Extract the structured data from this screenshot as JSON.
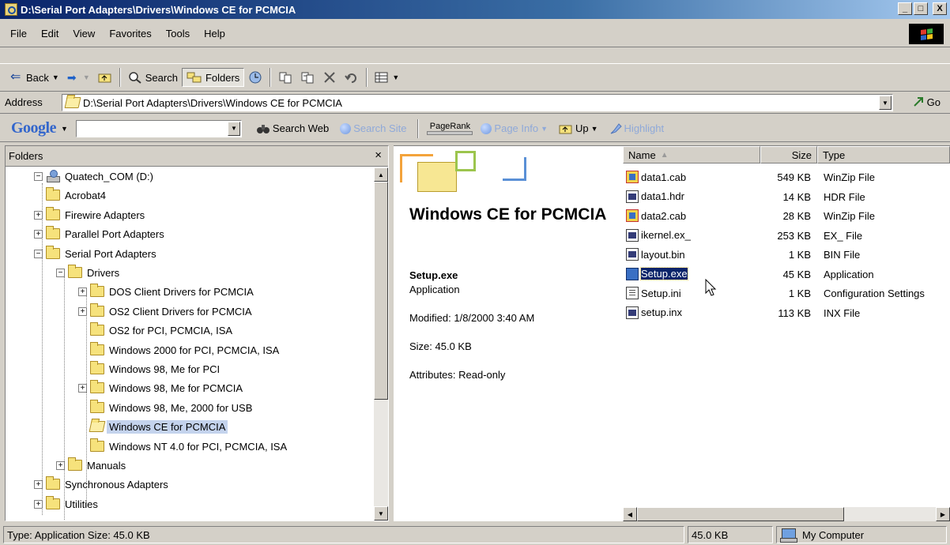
{
  "window": {
    "title": "D:\\Serial Port Adapters\\Drivers\\Windows CE for PCMCIA",
    "minimize": "_",
    "maximize": "□",
    "close": "X"
  },
  "menubar": [
    "File",
    "Edit",
    "View",
    "Favorites",
    "Tools",
    "Help"
  ],
  "toolbar": {
    "back_label": "Back",
    "search_label": "Search",
    "folders_label": "Folders"
  },
  "address": {
    "label": "Address",
    "value": "D:\\Serial Port Adapters\\Drivers\\Windows CE for PCMCIA",
    "go_label": "Go"
  },
  "googlebar": {
    "logo": "Google",
    "search_web": "Search Web",
    "search_site": "Search Site",
    "pagerank": "PageRank",
    "page_info": "Page Info",
    "up": "Up",
    "highlight": "Highlight"
  },
  "folder_pane": {
    "title": "Folders",
    "close": "×",
    "tree": [
      {
        "label": "Quatech_COM (D:)",
        "depth": 0,
        "expander": "−",
        "icon": "drive-icon"
      },
      {
        "label": "Acrobat4",
        "depth": 1,
        "expander": "",
        "icon": "folder-icon"
      },
      {
        "label": "Firewire Adapters",
        "depth": 1,
        "expander": "+",
        "icon": "folder-icon"
      },
      {
        "label": "Parallel Port Adapters",
        "depth": 1,
        "expander": "+",
        "icon": "folder-icon"
      },
      {
        "label": "Serial Port Adapters",
        "depth": 1,
        "expander": "−",
        "icon": "folder-icon"
      },
      {
        "label": "Drivers",
        "depth": 2,
        "expander": "−",
        "icon": "folder-icon"
      },
      {
        "label": "DOS Client Drivers for PCMCIA",
        "depth": 3,
        "expander": "+",
        "icon": "folder-icon"
      },
      {
        "label": "OS2 Client Drivers for PCMCIA",
        "depth": 3,
        "expander": "+",
        "icon": "folder-icon"
      },
      {
        "label": "OS2 for PCI, PCMCIA, ISA",
        "depth": 3,
        "expander": "",
        "icon": "folder-icon"
      },
      {
        "label": "Windows 2000 for PCI, PCMCIA, ISA",
        "depth": 3,
        "expander": "",
        "icon": "folder-icon"
      },
      {
        "label": "Windows 98, Me for PCI",
        "depth": 3,
        "expander": "",
        "icon": "folder-icon"
      },
      {
        "label": "Windows 98, Me for PCMCIA",
        "depth": 3,
        "expander": "+",
        "icon": "folder-icon"
      },
      {
        "label": "Windows 98, Me, 2000 for USB",
        "depth": 3,
        "expander": "",
        "icon": "folder-icon"
      },
      {
        "label": "Windows CE for PCMCIA",
        "depth": 3,
        "expander": "",
        "icon": "folder-open-icon",
        "selected": true
      },
      {
        "label": "Windows NT 4.0 for PCI, PCMCIA, ISA",
        "depth": 3,
        "expander": "",
        "icon": "folder-icon"
      },
      {
        "label": "Manuals",
        "depth": 2,
        "expander": "+",
        "icon": "folder-icon"
      },
      {
        "label": "Synchronous Adapters",
        "depth": 1,
        "expander": "+",
        "icon": "folder-icon"
      },
      {
        "label": "Utilities",
        "depth": 1,
        "expander": "+",
        "icon": "folder-icon"
      }
    ]
  },
  "details": {
    "folder_title": "Windows CE for PCMCIA",
    "file_name": "Setup.exe",
    "file_type": "Application",
    "modified": "Modified: 1/8/2000 3:40 AM",
    "size": "Size: 45.0 KB",
    "attributes": "Attributes: Read-only"
  },
  "file_list": {
    "columns": {
      "name": "Name",
      "size": "Size",
      "type": "Type"
    },
    "rows": [
      {
        "name": "data1.cab",
        "size": "549 KB",
        "type": "WinZip File",
        "icon": "zip"
      },
      {
        "name": "data1.hdr",
        "size": "14 KB",
        "type": "HDR File",
        "icon": "dat"
      },
      {
        "name": "data2.cab",
        "size": "28 KB",
        "type": "WinZip File",
        "icon": "zip"
      },
      {
        "name": "ikernel.ex_",
        "size": "253 KB",
        "type": "EX_ File",
        "icon": "dat"
      },
      {
        "name": "layout.bin",
        "size": "1 KB",
        "type": "BIN File",
        "icon": "dat"
      },
      {
        "name": "Setup.exe",
        "size": "45 KB",
        "type": "Application",
        "icon": "app",
        "selected": true
      },
      {
        "name": "Setup.ini",
        "size": "1 KB",
        "type": "Configuration Settings",
        "icon": "ini"
      },
      {
        "name": "setup.inx",
        "size": "113 KB",
        "type": "INX File",
        "icon": "dat"
      }
    ]
  },
  "statusbar": {
    "info": "Type: Application Size: 45.0 KB",
    "size": "45.0 KB",
    "zone": "My Computer"
  }
}
